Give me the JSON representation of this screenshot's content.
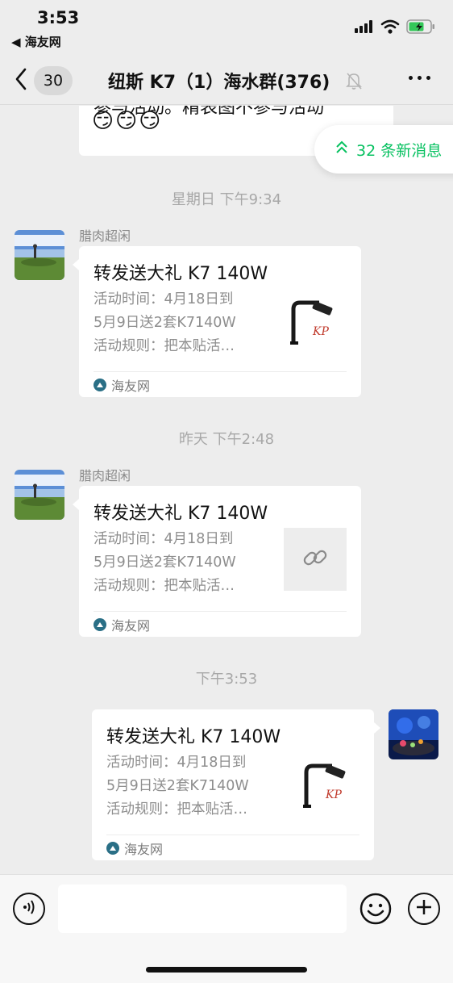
{
  "status_bar": {
    "time": "3:53",
    "back_app": "◀ 海友网"
  },
  "nav": {
    "back_count": "30",
    "title": "纽斯 K7（1）海水群(376)"
  },
  "chat": {
    "previous_message": {
      "text": "参与活动。精表图不参与活动",
      "emoji": "😏😏😏"
    },
    "new_messages_pill": "32 条新消息",
    "timestamps": [
      "星期日 下午9:34",
      "昨天 下午2:48",
      "下午3:53"
    ],
    "messages": [
      {
        "sender": "腊肉超闲",
        "title": "转发送大礼 K7 140W",
        "desc_lines": [
          "活动时间：4月18日到",
          "5月9日送2套K7140W",
          "活动规则：把本贴活…"
        ],
        "source": "海友网",
        "thumb_text": "KP"
      },
      {
        "sender": "腊肉超闲",
        "title": "转发送大礼 K7 140W",
        "desc_lines": [
          "活动时间：4月18日到",
          "5月9日送2套K7140W",
          "活动规则：把本贴活…"
        ],
        "source": "海友网"
      },
      {
        "title": "转发送大礼 K7 140W",
        "desc_lines": [
          "活动时间：4月18日到",
          "5月9日送2套K7140W",
          "活动规则：把本贴活…"
        ],
        "source": "海友网",
        "thumb_text": "KP"
      }
    ]
  },
  "colors": {
    "accent": "#07c160",
    "background": "#ededed"
  }
}
